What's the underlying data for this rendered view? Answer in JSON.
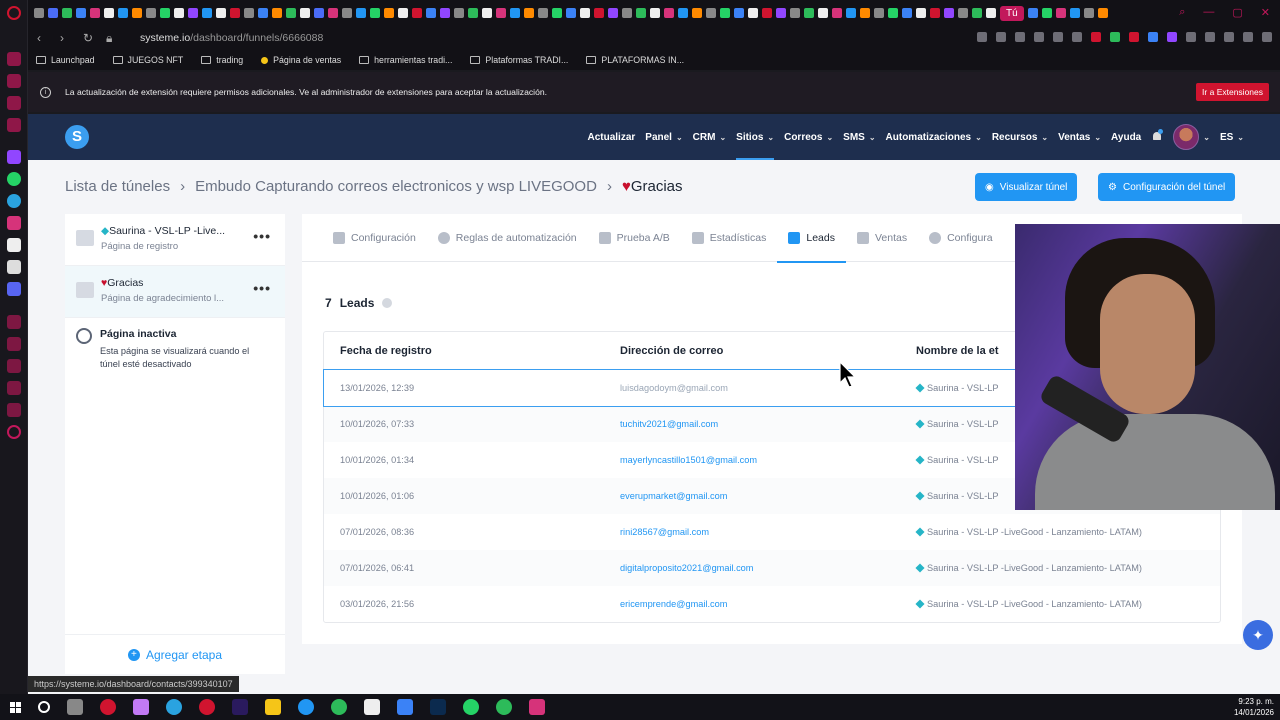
{
  "browser": {
    "active_tab_label": "Tú",
    "url_host": "systeme.io",
    "url_path": "/dashboard/funnels/6666088",
    "bookmarks": [
      "Launchpad",
      "JUEGOS NFT",
      "trading",
      "Página de ventas",
      "herramientas tradi...",
      "Plataformas TRADI...",
      "PLATAFORMAS IN..."
    ],
    "notice_text": "La actualización de extensión requiere permisos adicionales. Ve al administrador de extensiones para aceptar la actualización.",
    "notice_button": "Ir a Extensiones",
    "status_url": "https://systeme.io/dashboard/contacts/399340107"
  },
  "header": {
    "nav": [
      "Actualizar",
      "Panel",
      "CRM",
      "Sitios",
      "Correos",
      "SMS",
      "Automatizaciones",
      "Recursos",
      "Ventas",
      "Ayuda"
    ],
    "lang": "ES"
  },
  "breadcrumb": {
    "item1": "Lista de túneles",
    "item2": "Embudo Capturando correos electronicos y wsp LIVEGOOD",
    "current": "Gracias"
  },
  "actions": {
    "preview": "Visualizar túnel",
    "config": "Configuración del túnel"
  },
  "steps": [
    {
      "title": "Saurina - VSL-LP -Live...",
      "subtitle": "Página de registro"
    },
    {
      "title": "Gracias",
      "subtitle": "Página de agradecimiento l..."
    }
  ],
  "inactive": {
    "title": "Página inactiva",
    "desc1": "Esta página se visualizará cuando el",
    "desc2": "túnel esté desactivado"
  },
  "add_stage": "Agregar etapa",
  "tabs": [
    "Configuración",
    "Reglas de automatización",
    "Prueba A/B",
    "Estadísticas",
    "Leads",
    "Ventas",
    "Configura"
  ],
  "leads": {
    "count": "7",
    "label": "Leads",
    "columns": [
      "Fecha de registro",
      "Dirección de correo",
      "Nombre de la et"
    ],
    "rows": [
      {
        "date": "13/01/2026, 12:39",
        "email": "luisdagodoym@gmail.com",
        "page": "Saurina - VSL-LP"
      },
      {
        "date": "10/01/2026, 07:33",
        "email": "tuchitv2021@gmail.com",
        "page": "Saurina - VSL-LP"
      },
      {
        "date": "10/01/2026, 01:34",
        "email": "mayerlyncastillo1501@gmail.com",
        "page": "Saurina - VSL-LP"
      },
      {
        "date": "10/01/2026, 01:06",
        "email": "everupmarket@gmail.com",
        "page": "Saurina - VSL-LP"
      },
      {
        "date": "07/01/2026, 08:36",
        "email": "rini28567@gmail.com",
        "page": "Saurina - VSL-LP -LiveGood - Lanzamiento- LATAM)"
      },
      {
        "date": "07/01/2026, 06:41",
        "email": "digitalproposito2021@gmail.com",
        "page": "Saurina - VSL-LP -LiveGood - Lanzamiento- LATAM)"
      },
      {
        "date": "03/01/2026, 21:56",
        "email": "ericemprende@gmail.com",
        "page": "Saurina - VSL-LP -LiveGood - Lanzamiento- LATAM)"
      }
    ]
  },
  "taskbar": {
    "time": "9:23 p. m.",
    "date": "14/01/2026"
  },
  "colors": {
    "primary": "#2196f3",
    "header_bg": "#1e2e4e",
    "accent_red": "#d0142f"
  }
}
